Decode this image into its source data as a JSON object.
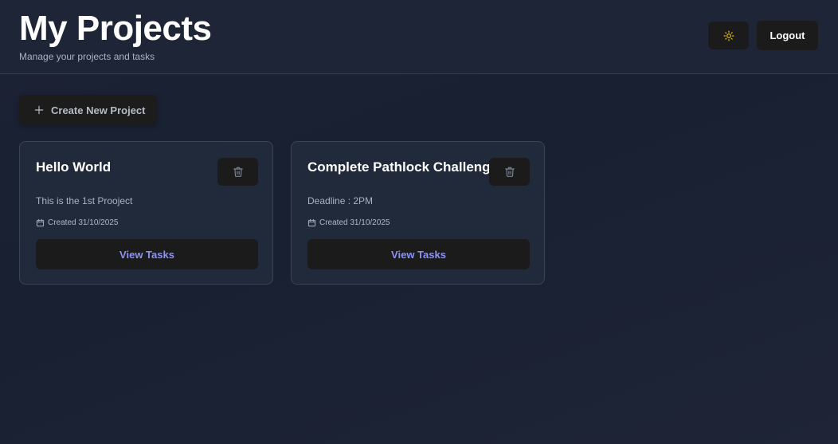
{
  "header": {
    "title": "My Projects",
    "subtitle": "Manage your projects and tasks",
    "theme_toggle_icon": "sun-icon",
    "logout_label": "Logout"
  },
  "toolbar": {
    "create_label": "Create New Project",
    "create_icon": "plus-icon"
  },
  "projects": [
    {
      "title": "Hello World",
      "description": "This is the 1st Prooject",
      "created": "Created 31/10/2025",
      "view_label": "View Tasks"
    },
    {
      "title": "Complete Pathlock Challenge",
      "description": "Deadline : 2PM",
      "created": "Created 31/10/2025",
      "view_label": "View Tasks"
    }
  ],
  "colors": {
    "background": "#1c2233",
    "card": "#212a3b",
    "button": "#1b1b1b",
    "link_accent": "#8b93f8",
    "sun_icon": "#f5c518"
  }
}
